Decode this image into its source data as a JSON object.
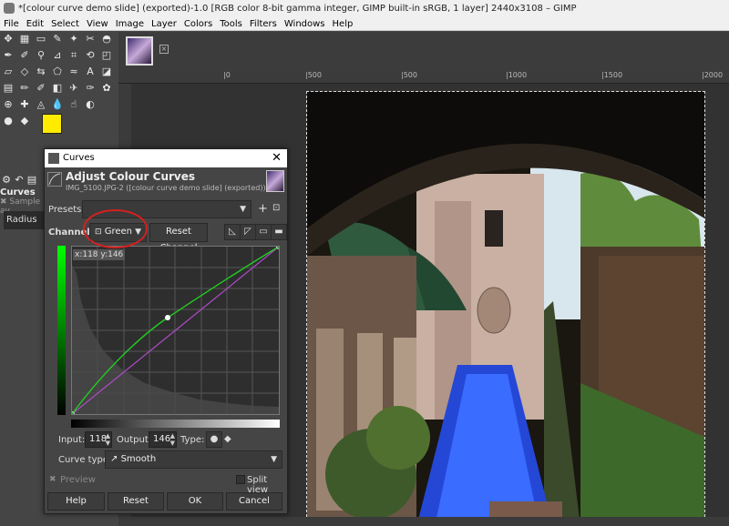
{
  "window": {
    "title": "*[colour curve demo slide] (exported)-1.0 [RGB color 8-bit gamma integer, GIMP built-in sRGB, 1 layer] 2440x3108 – GIMP"
  },
  "menu": [
    "File",
    "Edit",
    "Select",
    "View",
    "Image",
    "Layer",
    "Colors",
    "Tools",
    "Filters",
    "Windows",
    "Help"
  ],
  "ruler": {
    "labels": [
      "|500",
      "|0",
      "|500",
      "|1000",
      "|1500",
      "|2000"
    ]
  },
  "left_panel": {
    "tab_title": "Curves",
    "sample_label": "Sample av",
    "radius_label": "Radius"
  },
  "dialog": {
    "title": "Curves",
    "heading": "Adjust Colour Curves",
    "subheading": "IMG_5100.JPG-2 ([colour curve demo slide] (exported))",
    "presets_label": "Presets:",
    "presets_value": "",
    "channel_label": "Channel",
    "channel_value": "Green",
    "reset_channel": "Reset Channel",
    "coord_readout": "x:118 y:146",
    "input_label": "Input:",
    "input_value": "118",
    "output_label": "Output:",
    "output_value": "146",
    "type_label": "Type:",
    "curve_type_label": "Curve type:",
    "curve_type_value": "Smooth",
    "preview_label": "Preview",
    "split_view_label": "Split view",
    "buttons": {
      "help": "Help",
      "reset": "Reset",
      "ok": "OK",
      "cancel": "Cancel"
    }
  },
  "colors": {
    "accent_green": "#22cc22",
    "annotation_red": "#d42020"
  }
}
